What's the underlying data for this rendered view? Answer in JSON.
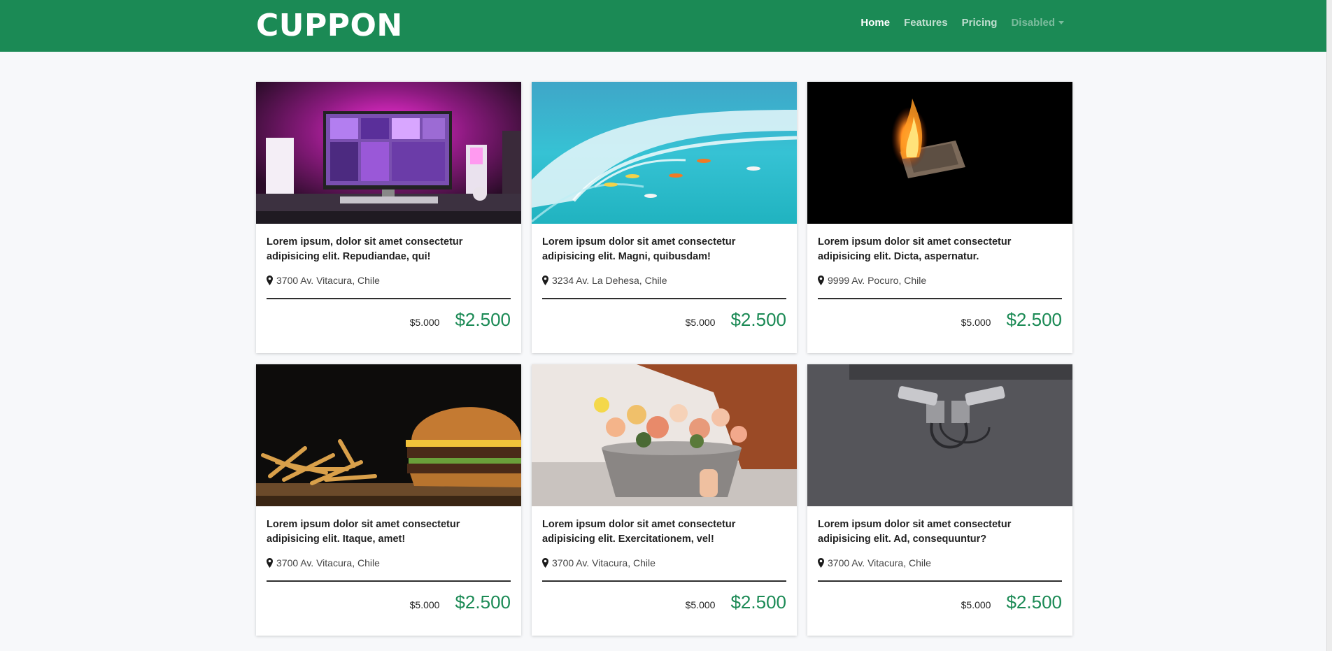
{
  "brand": "CUPPON",
  "nav": [
    {
      "label": "Home",
      "state": "active"
    },
    {
      "label": "Features",
      "state": "normal"
    },
    {
      "label": "Pricing",
      "state": "normal"
    },
    {
      "label": "Disabled",
      "state": "disabled"
    }
  ],
  "colors": {
    "primary": "#1b8a55",
    "background": "#f7f8fa"
  },
  "cards": [
    {
      "image": "desk-computer-pink-light-photo",
      "title": "Lorem ipsum, dolor sit amet consectetur adipisicing elit. Repudiandae, qui!",
      "location": "3700 Av. Vitacura, Chile",
      "old_price": "$5.000",
      "new_price": "$2.500"
    },
    {
      "image": "surfers-ocean-wave-photo",
      "title": "Lorem ipsum dolor sit amet consectetur adipisicing elit. Magni, quibusdam!",
      "location": "3234 Av. La Dehesa, Chile",
      "old_price": "$5.000",
      "new_price": "$2.500"
    },
    {
      "image": "burning-time-paper-photo",
      "title": "Lorem ipsum dolor sit amet consectetur adipisicing elit. Dicta, aspernatur.",
      "location": "9999 Av. Pocuro, Chile",
      "old_price": "$5.000",
      "new_price": "$2.500"
    },
    {
      "image": "burger-fries-photo",
      "title": "Lorem ipsum dolor sit amet consectetur adipisicing elit. Itaque, amet!",
      "location": "3700 Av. Vitacura, Chile",
      "old_price": "$5.000",
      "new_price": "$2.500"
    },
    {
      "image": "flower-bouquet-photo",
      "title": "Lorem ipsum dolor sit amet consectetur adipisicing elit. Exercitationem, vel!",
      "location": "3700 Av. Vitacura, Chile",
      "old_price": "$5.000",
      "new_price": "$2.500"
    },
    {
      "image": "security-cameras-wall-photo",
      "title": "Lorem ipsum dolor sit amet consectetur adipisicing elit. Ad, consequuntur?",
      "location": "3700 Av. Vitacura, Chile",
      "old_price": "$5.000",
      "new_price": "$2.500"
    }
  ]
}
